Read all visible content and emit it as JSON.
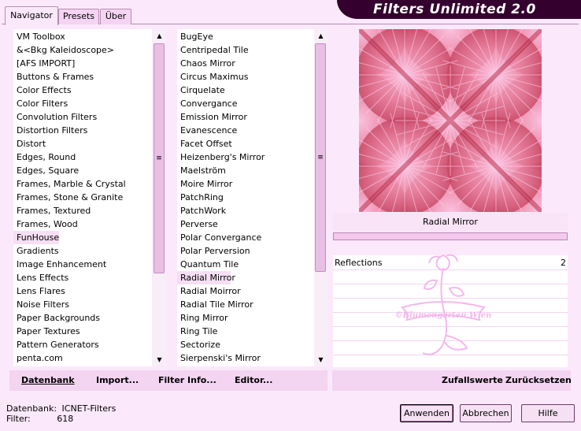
{
  "title": "Filters Unlimited 2.0",
  "tabs": [
    {
      "label": "Navigator",
      "active": true
    },
    {
      "label": "Presets",
      "active": false
    },
    {
      "label": "Über",
      "active": false
    }
  ],
  "categories": [
    " VM Toolbox",
    "&<Bkg Kaleidoscope>",
    "[AFS IMPORT]",
    "Buttons & Frames",
    "Color Effects",
    "Color Filters",
    "Convolution Filters",
    "Distortion Filters",
    "Distort",
    "Edges, Round",
    "Edges, Square",
    "Frames, Marble & Crystal",
    "Frames, Stone & Granite",
    "Frames, Textured",
    "Frames, Wood",
    "FunHouse",
    "Gradients",
    "Image Enhancement",
    "Lens Effects",
    "Lens Flares",
    "Noise Filters",
    "Paper Backgrounds",
    "Paper Textures",
    "Pattern Generators",
    "penta.com"
  ],
  "selected_category": "FunHouse",
  "filters": [
    "BugEye",
    "Centripedal Tile",
    "Chaos Mirror",
    "Circus Maximus",
    "Cirquelate",
    "Convergance",
    "Emission Mirror",
    "Evanescence",
    "Facet Offset",
    "Heizenberg's Mirror",
    "Maelström",
    "Moire Mirror",
    "PatchRing",
    "PatchWork",
    "Perverse",
    "Polar Convergance",
    "Polar Perversion",
    "Quantum Tile",
    "Radial Mirror",
    "Radial Moirror",
    "Radial Tile Mirror",
    "Ring Mirror",
    "Ring Tile",
    "Sectorize",
    "Sierpenski's Mirror"
  ],
  "selected_filter": "Radial Mirror",
  "left_buttons": {
    "database": "Datenbank",
    "import": "Import...",
    "filter_info": "Filter Info...",
    "editor": "Editor..."
  },
  "preview": {
    "filter_name": "Radial Mirror",
    "colors": {
      "light": "#ffd6f2",
      "mid": "#ec8aa8",
      "dark": "#b3233f"
    }
  },
  "parameters": [
    {
      "name": "Reflections",
      "value": "2"
    }
  ],
  "watermark": "©Blumengarten Wien",
  "right_buttons": {
    "random": "Zufallswerte",
    "reset": "Zurücksetzen"
  },
  "status": {
    "db_label": "Datenbank:",
    "db_value": "ICNET-Filters",
    "filter_label": "Filter:",
    "filter_value": "618"
  },
  "dialog_buttons": {
    "apply": "Anwenden",
    "cancel": "Abbrechen",
    "help": "Hilfe"
  }
}
